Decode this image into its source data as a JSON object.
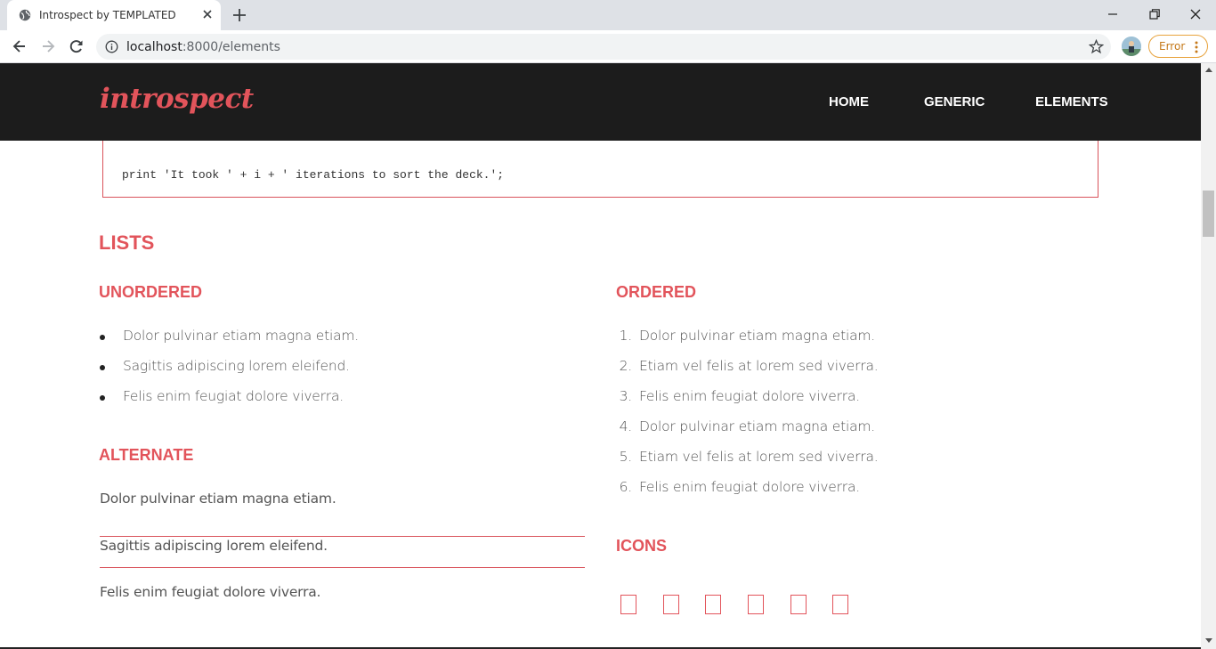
{
  "browser": {
    "tab_title": "Introspect by TEMPLATED",
    "url_host": "localhost",
    "url_rest": ":8000/elements",
    "error_label": "Error"
  },
  "site": {
    "logo": "introspect",
    "nav": [
      "HOME",
      "GENERIC",
      "ELEMENTS"
    ]
  },
  "code": {
    "last_line": "print 'It took ' + i + ' iterations to sort the deck.';"
  },
  "lists": {
    "title": "LISTS",
    "unordered": {
      "title": "UNORDERED",
      "items": [
        "Dolor pulvinar etiam magna etiam.",
        "Sagittis adipiscing lorem eleifend.",
        "Felis enim feugiat dolore viverra."
      ]
    },
    "alternate": {
      "title": "ALTERNATE",
      "items": [
        "Dolor pulvinar etiam magna etiam.",
        "Sagittis adipiscing lorem eleifend.",
        "Felis enim feugiat dolore viverra."
      ]
    },
    "ordered": {
      "title": "ORDERED",
      "numbers": [
        "1.",
        "2.",
        "3.",
        "4.",
        "5.",
        "6."
      ],
      "items": [
        "Dolor pulvinar etiam magna etiam.",
        "Etiam vel felis at lorem sed viverra.",
        "Felis enim feugiat dolore viverra.",
        "Dolor pulvinar etiam magna etiam.",
        "Etiam vel felis at lorem sed viverra.",
        "Felis enim feugiat dolore viverra."
      ]
    },
    "icons": {
      "title": "ICONS",
      "items": [
        "missing-glyph-icon",
        "missing-glyph-icon",
        "missing-glyph-icon",
        "missing-glyph-icon",
        "missing-glyph-icon",
        "missing-glyph-icon"
      ]
    }
  },
  "colors": {
    "accent": "#e2545b",
    "header_bg": "#1c1c1c",
    "text": "#555555"
  }
}
